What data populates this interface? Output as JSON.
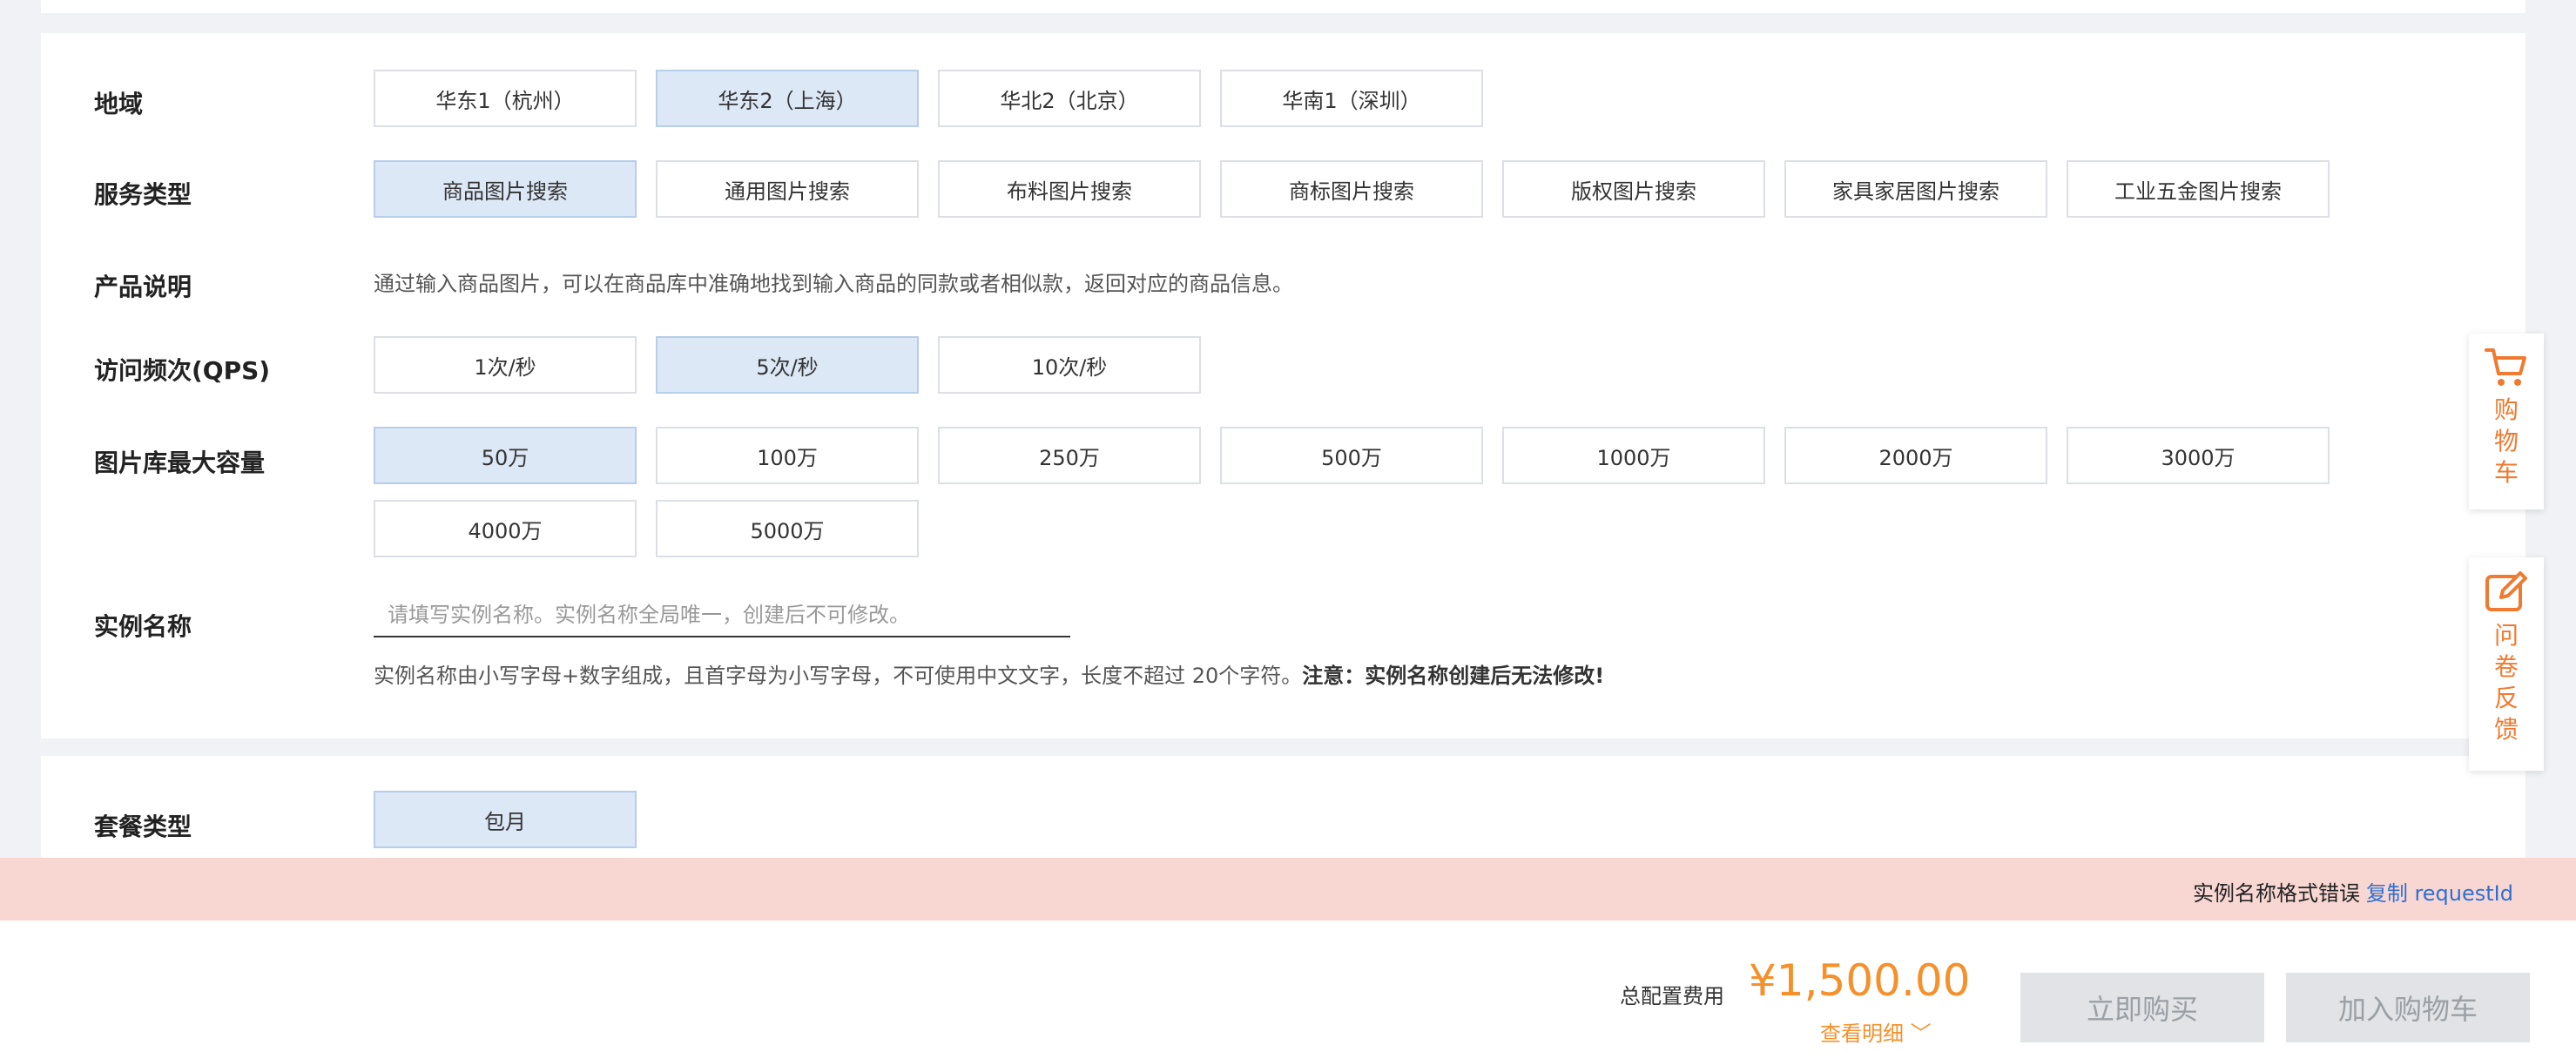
{
  "region": {
    "label": "地域",
    "options": [
      "华东1（杭州）",
      "华东2（上海）",
      "华北2（北京）",
      "华南1（深圳）"
    ],
    "selected": "华东2（上海）"
  },
  "service": {
    "label": "服务类型",
    "options": [
      "商品图片搜索",
      "通用图片搜索",
      "布料图片搜索",
      "商标图片搜索",
      "版权图片搜索",
      "家具家居图片搜索",
      "工业五金图片搜索"
    ],
    "selected": "商品图片搜索"
  },
  "product": {
    "label": "产品说明",
    "desc": "通过输入商品图片，可以在商品库中准确地找到输入商品的同款或者相似款，返回对应的商品信息。"
  },
  "qps": {
    "label": "访问频次(QPS)",
    "options": [
      "1次/秒",
      "5次/秒",
      "10次/秒"
    ],
    "selected": "5次/秒"
  },
  "capacity": {
    "label": "图片库最大容量",
    "options": [
      "50万",
      "100万",
      "250万",
      "500万",
      "1000万",
      "2000万",
      "3000万",
      "4000万",
      "5000万"
    ],
    "selected": "50万"
  },
  "instance": {
    "label": "实例名称",
    "placeholder": "请填写实例名称。实例名称全局唯一，创建后不可修改。",
    "value": "",
    "hint": "实例名称由小写字母+数字组成，且首字母为小写字母，不可使用中文文字，长度不超过 20个字符。",
    "hint_strong": "注意：实例名称创建后无法修改!"
  },
  "package": {
    "label": "套餐类型",
    "options": [
      "包月"
    ],
    "selected": "包月"
  },
  "error": {
    "message": "实例名称格式错误",
    "link": "复制 requestId"
  },
  "footer": {
    "fee_label": "总配置费用",
    "fee_value": "¥1,500.00",
    "detail": "查看明细",
    "buy": "立即购买",
    "add_cart": "加入购物车"
  },
  "side": {
    "cart": "购物车",
    "survey": "问卷反馈"
  },
  "colors": {
    "accent": "#f5902b",
    "selected_bg": "#dde8f6",
    "error_bg": "#f8d7d3",
    "link": "#2f6fd1"
  }
}
